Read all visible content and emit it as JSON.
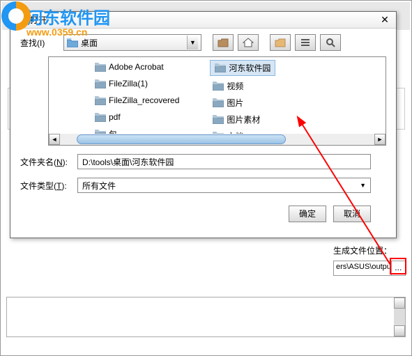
{
  "watermark": {
    "name": "河东软件园",
    "url": "www.0359.cn"
  },
  "dialog": {
    "title": "打开",
    "lookin_label": "查找(I)",
    "lookin_value": "桌面",
    "columns": [
      [
        "Adobe Acrobat",
        "FileZilla(1)",
        "FileZilla_recovered",
        "pdf",
        "包"
      ],
      [
        "河东软件园",
        "视频",
        "图片",
        "图片素材",
        "文档"
      ]
    ],
    "selected": "河东软件园",
    "foldername_label": "文件夹名(N):",
    "foldername_value": "D:\\tools\\桌面\\河东软件园",
    "filetype_label": "文件类型(T):",
    "filetype_value": "所有文件",
    "ok": "确定",
    "cancel": "取消"
  },
  "bg": {
    "gen_label": "生成文件位置：",
    "out_path": "ers\\ASUS\\output",
    "browse": "..."
  }
}
